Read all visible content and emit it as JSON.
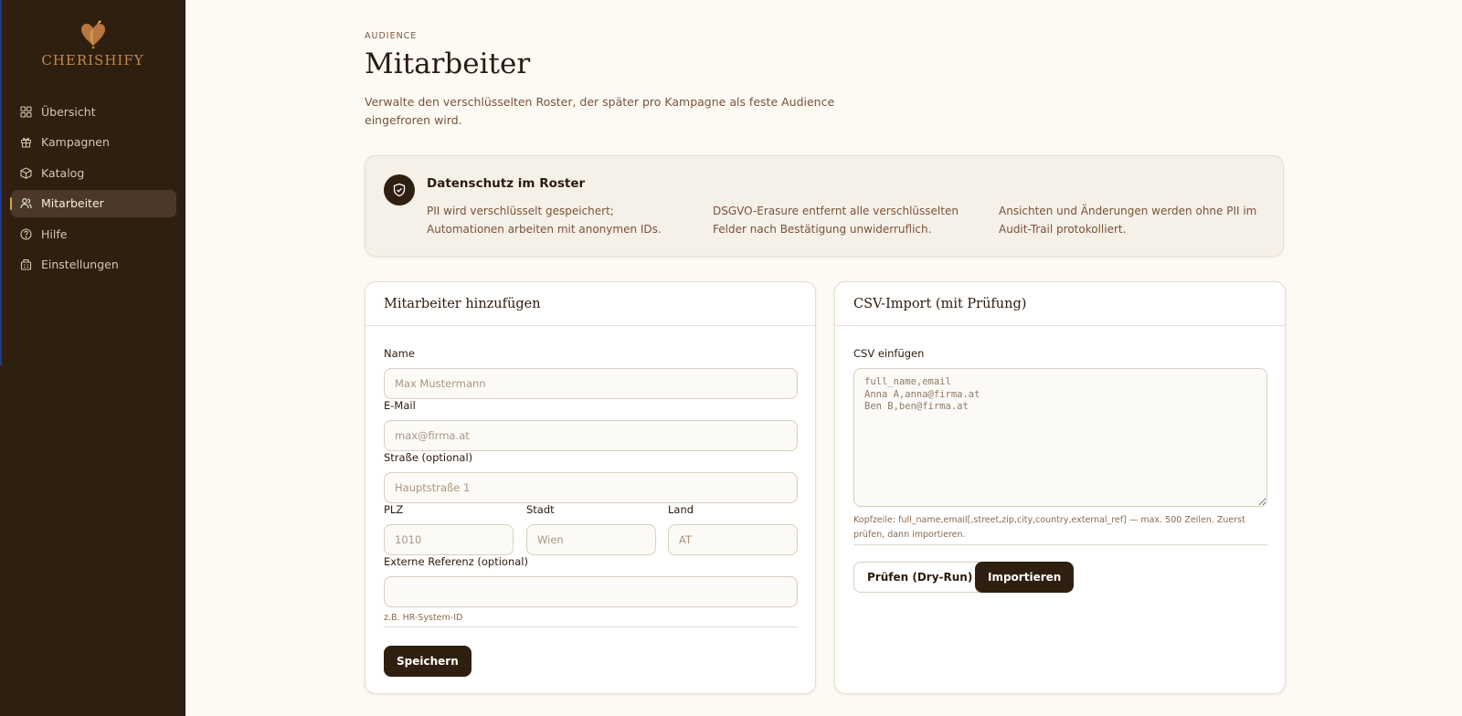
{
  "brand": {
    "name": "CHERISHIFY"
  },
  "nav": [
    {
      "label": "Übersicht",
      "icon": "grid-icon"
    },
    {
      "label": "Kampagnen",
      "icon": "gift-icon"
    },
    {
      "label": "Katalog",
      "icon": "box-icon"
    },
    {
      "label": "Mitarbeiter",
      "icon": "users-icon",
      "active": true
    },
    {
      "label": "Hilfe",
      "icon": "help-circle-icon"
    },
    {
      "label": "Einstellungen",
      "icon": "building-icon"
    }
  ],
  "header": {
    "eyebrow": "AUDIENCE",
    "title": "Mitarbeiter",
    "description": "Verwalte den verschlüsselten Roster, der später pro Kampagne als feste Audience eingefroren wird."
  },
  "privacy": {
    "title": "Datenschutz im Roster",
    "col1": "PII wird verschlüsselt gespeichert; Automationen arbeiten mit anonymen IDs.",
    "col2": "DSGVO-Erasure entfernt alle verschlüsselten Felder nach Bestätigung unwiderruflich.",
    "col3": "Ansichten und Änderungen werden ohne PII im Audit-Trail protokolliert."
  },
  "add_form": {
    "title": "Mitarbeiter hinzufügen",
    "name_label": "Name",
    "name_placeholder": "Max Mustermann",
    "email_label": "E-Mail",
    "email_placeholder": "max@firma.at",
    "street_label": "Straße (optional)",
    "street_placeholder": "Hauptstraße 1",
    "zip_label": "PLZ",
    "zip_placeholder": "1010",
    "city_label": "Stadt",
    "city_placeholder": "Wien",
    "country_label": "Land",
    "country_placeholder": "AT",
    "ref_label": "Externe Referenz (optional)",
    "ref_placeholder": "",
    "ref_hint": "z.B. HR-System-ID",
    "save_label": "Speichern"
  },
  "csv_import": {
    "title": "CSV-Import (mit Prüfung)",
    "label": "CSV einfügen",
    "placeholder": "full_name,email\nAnna A,anna@firma.at\nBen B,ben@firma.at",
    "hint": "Kopfzeile: full_name,email[,street,zip,city,country,external_ref] — max. 500 Zeilen. Zuerst prüfen, dann importieren.",
    "dry_run_label": "Prüfen (Dry-Run)",
    "import_label": "Importieren"
  }
}
